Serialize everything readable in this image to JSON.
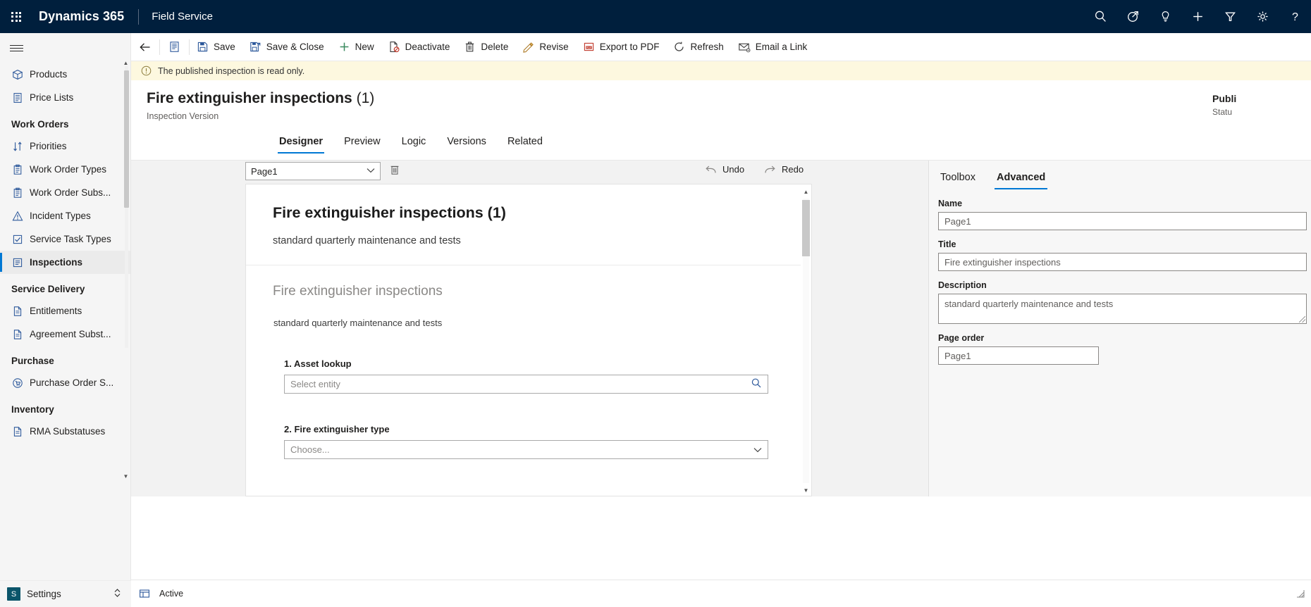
{
  "topnav": {
    "waffle_icon": "waffle-grid-icon",
    "brand": "Dynamics 365",
    "app_name": "Field Service",
    "right_icons": [
      {
        "name": "search-icon",
        "label": "Search"
      },
      {
        "name": "diagnostics-icon",
        "label": "Diagnostics"
      },
      {
        "name": "lightbulb-icon",
        "label": "Ideas"
      },
      {
        "name": "plus-icon",
        "label": "Quick create"
      },
      {
        "name": "filter-icon",
        "label": "Filter"
      },
      {
        "name": "gear-icon",
        "label": "Settings"
      },
      {
        "name": "help-icon",
        "label": "Help"
      }
    ]
  },
  "sidebar": {
    "hamburger_icon": "hamburger-icon",
    "entries": [
      {
        "type": "item",
        "label": "Products",
        "icon": "box-icon",
        "selected": false
      },
      {
        "type": "item",
        "label": "Price Lists",
        "icon": "list-icon",
        "selected": false
      },
      {
        "type": "group",
        "label": "Work Orders"
      },
      {
        "type": "item",
        "label": "Priorities",
        "icon": "priority-icon",
        "selected": false
      },
      {
        "type": "item",
        "label": "Work Order Types",
        "icon": "clipboard-icon",
        "selected": false
      },
      {
        "type": "item",
        "label": "Work Order Subs...",
        "icon": "clipboard-icon",
        "selected": false
      },
      {
        "type": "item",
        "label": "Incident Types",
        "icon": "warning-icon",
        "selected": false
      },
      {
        "type": "item",
        "label": "Service Task Types",
        "icon": "task-icon",
        "selected": false
      },
      {
        "type": "item",
        "label": "Inspections",
        "icon": "inspection-icon",
        "selected": true
      },
      {
        "type": "group",
        "label": "Service Delivery"
      },
      {
        "type": "item",
        "label": "Entitlements",
        "icon": "document-icon",
        "selected": false
      },
      {
        "type": "item",
        "label": "Agreement Subst...",
        "icon": "document-icon",
        "selected": false
      },
      {
        "type": "group",
        "label": "Purchase"
      },
      {
        "type": "item",
        "label": "Purchase Order S...",
        "icon": "cart-icon",
        "selected": false
      },
      {
        "type": "group",
        "label": "Inventory"
      },
      {
        "type": "item",
        "label": "RMA Substatuses",
        "icon": "document-icon",
        "selected": false
      }
    ],
    "settings": {
      "badge": "S",
      "label": "Settings",
      "chevron_icon": "chevron-updown-icon"
    }
  },
  "commandbar": {
    "back_icon": "arrow-left-icon",
    "form_icon": "form-icon",
    "buttons": [
      {
        "label": "Save",
        "icon": "save-icon"
      },
      {
        "label": "Save & Close",
        "icon": "save-close-icon"
      },
      {
        "label": "New",
        "icon": "plus-icon"
      },
      {
        "label": "Deactivate",
        "icon": "deactivate-icon"
      },
      {
        "label": "Delete",
        "icon": "trash-icon"
      },
      {
        "label": "Revise",
        "icon": "pencil-icon"
      },
      {
        "label": "Export to PDF",
        "icon": "pdf-icon"
      },
      {
        "label": "Refresh",
        "icon": "refresh-icon"
      },
      {
        "label": "Email a Link",
        "icon": "email-link-icon"
      }
    ]
  },
  "notification": {
    "icon": "info-circle-icon",
    "text": "The published inspection is read only."
  },
  "form_header": {
    "title": "Fire extinguisher inspections",
    "version": "(1)",
    "subtitle": "Inspection Version",
    "status_value": "Publi",
    "status_label": "Statu"
  },
  "tabs": [
    {
      "label": "Designer",
      "active": true
    },
    {
      "label": "Preview",
      "active": false
    },
    {
      "label": "Logic",
      "active": false
    },
    {
      "label": "Versions",
      "active": false
    },
    {
      "label": "Related",
      "active": false
    }
  ],
  "designer_toolbar": {
    "page_select_value": "Page1",
    "page_select_chevron": "chevron-down-icon",
    "delete_page_icon": "trash-icon",
    "undo_label": "Undo",
    "undo_icon": "undo-icon",
    "redo_label": "Redo",
    "redo_icon": "redo-icon"
  },
  "canvas": {
    "header_title": "Fire extinguisher inspections (1)",
    "header_subtitle": "standard quarterly maintenance and tests",
    "form_title": "Fire extinguisher inspections",
    "form_description": "standard quarterly maintenance and tests",
    "questions": [
      {
        "label": "1. Asset lookup",
        "placeholder": "Select entity",
        "field_icon": "search-icon",
        "field_type": "lookup"
      },
      {
        "label": "2. Fire extinguisher type",
        "placeholder": "Choose...",
        "field_icon": "chevron-down-icon",
        "field_type": "dropdown"
      }
    ],
    "scrollbar": {
      "up_icon": "caret-up-icon",
      "down_icon": "caret-down-icon"
    }
  },
  "right_panel": {
    "tabs": [
      {
        "label": "Toolbox",
        "active": false
      },
      {
        "label": "Advanced",
        "active": true
      }
    ],
    "fields": [
      {
        "label": "Name",
        "value": "Page1",
        "type": "input"
      },
      {
        "label": "Title",
        "value": "Fire extinguisher inspections",
        "type": "input"
      },
      {
        "label": "Description",
        "value": "standard quarterly maintenance and tests",
        "type": "textarea"
      },
      {
        "label": "Page order",
        "value": "Page1",
        "type": "input-narrow"
      }
    ]
  },
  "footer": {
    "icon": "form-status-icon",
    "status": "Active",
    "right_icon": "resize-icon"
  },
  "colors": {
    "navbar_bg": "#001f3d",
    "accent": "#0078d4",
    "notification_bg": "#fdf8df",
    "sidebar_bg": "#f5f5f5",
    "designer_bg": "#f2f2f2",
    "panel_bg": "#f7f7f7",
    "icon_blue": "#2b579a"
  }
}
